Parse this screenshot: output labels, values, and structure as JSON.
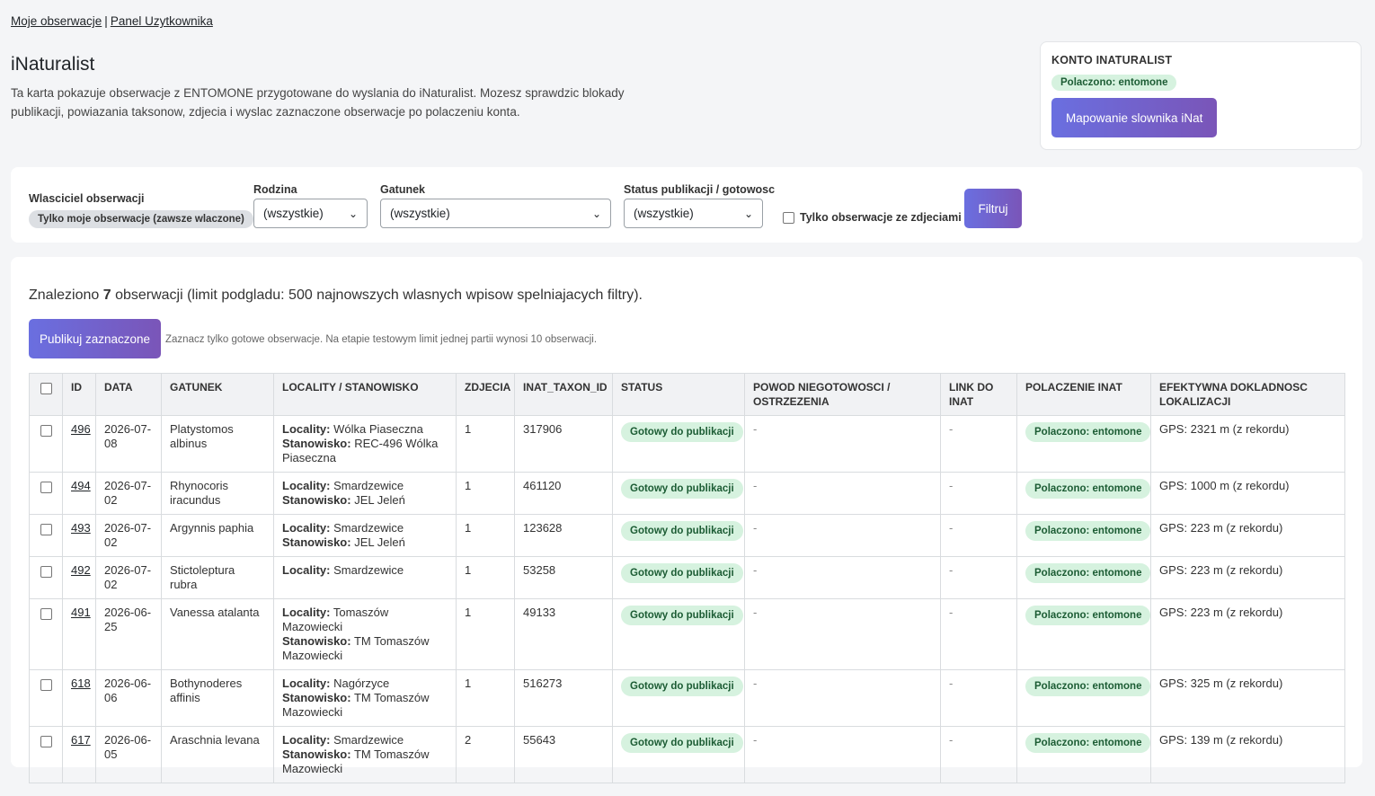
{
  "nav": {
    "link1": "Moje obserwacje",
    "separator": "|",
    "link2": "Panel Uzytkownika"
  },
  "page": {
    "title": "iNaturalist",
    "intro": "Ta karta pokazuje obserwacje z ENTOMONE przygotowane do wyslania do iNaturalist. Mozesz sprawdzic blokady publikacji, powiazania taksonow, zdjecia i wyslac zaznaczone obserwacje po polaczeniu konta."
  },
  "account": {
    "heading": "KONTO INATURALIST",
    "status": "Polaczono: entomone",
    "mapping_button": "Mapowanie slownika iNat"
  },
  "filters": {
    "owner_label": "Wlasciciel obserwacji",
    "owner_value": "Tylko moje obserwacje (zawsze wlaczone)",
    "family_label": "Rodzina",
    "family_value": "(wszystkie)",
    "species_label": "Gatunek",
    "species_value": "(wszystkie)",
    "status_label": "Status publikacji / gotowosc",
    "status_value": "(wszystkie)",
    "photos_only_label": "Tylko obserwacje ze zdjeciami",
    "filter_button": "Filtruj"
  },
  "results": {
    "found_prefix": "Znaleziono ",
    "found_count": "7",
    "found_suffix": " obserwacji (limit podgladu: 500 najnowszych wlasnych wpisow spelniajacych filtry).",
    "publish_button": "Publikuj zaznaczone",
    "hint": "Zaznacz tylko gotowe obserwacje. Na etapie testowym limit jednej partii wynosi 10 obserwacji."
  },
  "table": {
    "headers": {
      "id": "ID",
      "date": "DATA",
      "species": "GATUNEK",
      "locality": "LOCALITY / STANOWISKO",
      "photos": "ZDJECIA",
      "taxon": "INAT_TAXON_ID",
      "status": "STATUS",
      "reason": "POWOD NIEGOTOWOSCI / OSTRZEZENIA",
      "link": "LINK DO INAT",
      "connection": "POLACZENIE INAT",
      "accuracy": "EFEKTYWNA DOKLADNOSC LOKALIZACJI"
    },
    "locality_label": "Locality:",
    "site_label": "Stanowisko:",
    "rows": [
      {
        "id": "496",
        "date": "2026-07-08",
        "species": "Platystomos albinus",
        "locality": "Wólka Piaseczna",
        "site": "REC-496 Wólka Piaseczna",
        "photos": "1",
        "taxon": "317906",
        "status": "Gotowy do publikacji",
        "reason": "-",
        "link": "-",
        "connection": "Polaczono: entomone",
        "accuracy": "GPS: 2321 m (z rekordu)"
      },
      {
        "id": "494",
        "date": "2026-07-02",
        "species": "Rhynocoris iracundus",
        "locality": "Smardzewice",
        "site": "JEL Jeleń",
        "photos": "1",
        "taxon": "461120",
        "status": "Gotowy do publikacji",
        "reason": "-",
        "link": "-",
        "connection": "Polaczono: entomone",
        "accuracy": "GPS: 1000 m (z rekordu)"
      },
      {
        "id": "493",
        "date": "2026-07-02",
        "species": "Argynnis paphia",
        "locality": "Smardzewice",
        "site": "JEL Jeleń",
        "photos": "1",
        "taxon": "123628",
        "status": "Gotowy do publikacji",
        "reason": "-",
        "link": "-",
        "connection": "Polaczono: entomone",
        "accuracy": "GPS: 223 m (z rekordu)"
      },
      {
        "id": "492",
        "date": "2026-07-02",
        "species": "Stictoleptura rubra",
        "locality": "Smardzewice",
        "site": "",
        "photos": "1",
        "taxon": "53258",
        "status": "Gotowy do publikacji",
        "reason": "-",
        "link": "-",
        "connection": "Polaczono: entomone",
        "accuracy": "GPS: 223 m (z rekordu)"
      },
      {
        "id": "491",
        "date": "2026-06-25",
        "species": "Vanessa atalanta",
        "locality": "Tomaszów Mazowiecki",
        "site": "TM Tomaszów Mazowiecki",
        "photos": "1",
        "taxon": "49133",
        "status": "Gotowy do publikacji",
        "reason": "-",
        "link": "-",
        "connection": "Polaczono: entomone",
        "accuracy": "GPS: 223 m (z rekordu)"
      },
      {
        "id": "618",
        "date": "2026-06-06",
        "species": "Bothynoderes affinis",
        "locality": "Nagórzyce",
        "site": "TM Tomaszów Mazowiecki",
        "photos": "1",
        "taxon": "516273",
        "status": "Gotowy do publikacji",
        "reason": "-",
        "link": "-",
        "connection": "Polaczono: entomone",
        "accuracy": "GPS: 325 m (z rekordu)"
      },
      {
        "id": "617",
        "date": "2026-06-05",
        "species": "Araschnia levana",
        "locality": "Smardzewice",
        "site": "TM Tomaszów Mazowiecki",
        "photos": "2",
        "taxon": "55643",
        "status": "Gotowy do publikacji",
        "reason": "-",
        "link": "-",
        "connection": "Polaczono: entomone",
        "accuracy": "GPS: 139 m (z rekordu)"
      }
    ]
  }
}
